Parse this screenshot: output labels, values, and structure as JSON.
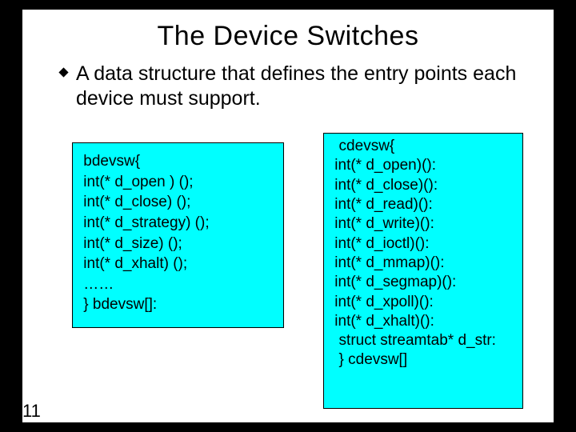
{
  "slide": {
    "title": "The Device Switches",
    "bullet": "A data structure that defines the entry points each device must support.",
    "page_number": "11"
  },
  "left_code": " bdevsw{\n int(* d_open ) ();\n int(* d_close) ();\n int(* d_strategy) ();\n int(* d_size) ();\n int(* d_xhalt) ();\n ……\n } bdevsw[]:",
  "right_code": "  cdevsw{\n int(* d_open)():\n int(* d_close)():\n int(* d_read)():\n int(* d_write)():\n int(* d_ioctl)():\n int(* d_mmap)():\n int(* d_segmap)():\n int(* d_xpoll)():\n int(* d_xhalt)():\n  struct streamtab* d_str:\n  } cdevsw[]"
}
